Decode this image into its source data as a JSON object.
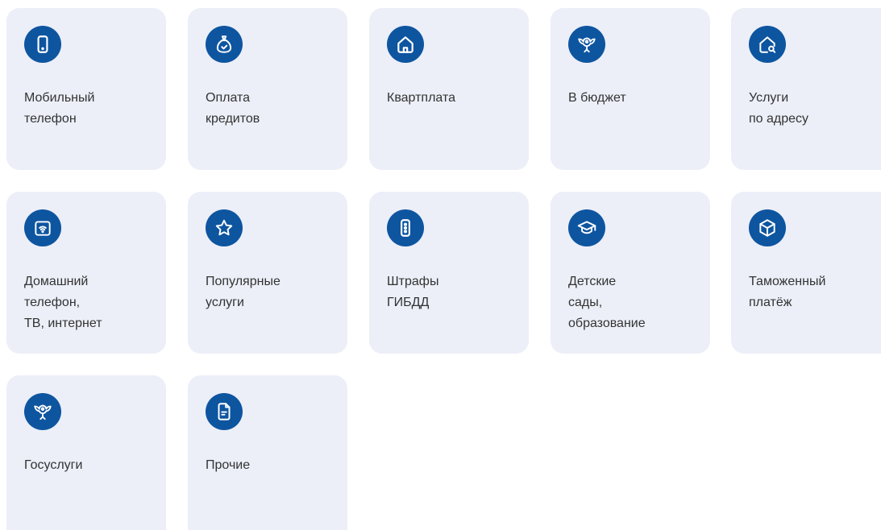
{
  "tiles": [
    {
      "icon": "phone-icon",
      "label": [
        "Мобильный",
        "телефон"
      ]
    },
    {
      "icon": "money-bag-icon",
      "label": [
        "Оплата",
        "кредитов"
      ]
    },
    {
      "icon": "house-icon",
      "label": [
        "Квартплата"
      ]
    },
    {
      "icon": "emblem-icon",
      "label": [
        "В бюджет"
      ]
    },
    {
      "icon": "house-search-icon",
      "label": [
        "Услуги",
        "по адресу"
      ]
    },
    {
      "icon": "router-wifi-icon",
      "label": [
        "Домашний",
        "телефон,",
        "ТВ, интернет"
      ]
    },
    {
      "icon": "star-icon",
      "label": [
        "Популярные",
        "услуги"
      ]
    },
    {
      "icon": "traffic-light-icon",
      "label": [
        "Штрафы",
        "ГИБДД"
      ]
    },
    {
      "icon": "graduation-cap-icon",
      "label": [
        "Детские",
        "сады,",
        "образование"
      ]
    },
    {
      "icon": "box-icon",
      "label": [
        "Таможенный",
        "платёж"
      ]
    },
    {
      "icon": "emblem-icon",
      "label": [
        "Госуслуги"
      ]
    },
    {
      "icon": "document-icon",
      "label": [
        "Прочие"
      ]
    }
  ],
  "colors": {
    "tile_bg": "#eceff8",
    "icon_bg": "#0e55a0",
    "text": "#333333"
  }
}
